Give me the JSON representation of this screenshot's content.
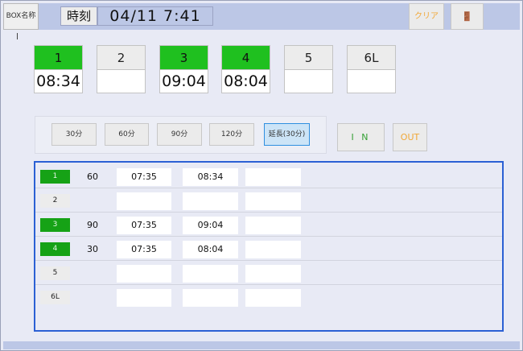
{
  "header": {
    "box_name_label": "BOX名称",
    "clock_label": "時刻",
    "clock_value": "04/11  7:41",
    "clear_label": "クリア",
    "exit_icon": "exit-door-icon",
    "exit_glyph": "🚪"
  },
  "tiles": [
    {
      "label": "1",
      "time": "08:34",
      "active": true
    },
    {
      "label": "2",
      "time": "",
      "active": false
    },
    {
      "label": "3",
      "time": "09:04",
      "active": true
    },
    {
      "label": "4",
      "time": "08:04",
      "active": true
    },
    {
      "label": "5",
      "time": "",
      "active": false
    },
    {
      "label": "6L",
      "time": "",
      "active": false
    }
  ],
  "durations": [
    {
      "label": "30分",
      "selected": false
    },
    {
      "label": "60分",
      "selected": false
    },
    {
      "label": "90分",
      "selected": false
    },
    {
      "label": "120分",
      "selected": false
    },
    {
      "label": "延長(30分)",
      "selected": true
    }
  ],
  "io": {
    "in_label": "I N",
    "out_label": "OUT"
  },
  "rows": [
    {
      "box": "1",
      "active": true,
      "duration": "60",
      "start": "07:35",
      "end": "08:34",
      "extra": ""
    },
    {
      "box": "2",
      "active": false,
      "duration": "",
      "start": "",
      "end": "",
      "extra": ""
    },
    {
      "box": "3",
      "active": true,
      "duration": "90",
      "start": "07:35",
      "end": "09:04",
      "extra": ""
    },
    {
      "box": "4",
      "active": true,
      "duration": "30",
      "start": "07:35",
      "end": "08:04",
      "extra": ""
    },
    {
      "box": "5",
      "active": false,
      "duration": "",
      "start": "",
      "end": "",
      "extra": ""
    },
    {
      "box": "6L",
      "active": false,
      "duration": "",
      "start": "",
      "end": "",
      "extra": ""
    }
  ],
  "colors": {
    "active_green": "#1fc01f",
    "badge_green": "#16a216",
    "frame_blue": "#2b60d4",
    "accent_orange": "#f1a838"
  }
}
